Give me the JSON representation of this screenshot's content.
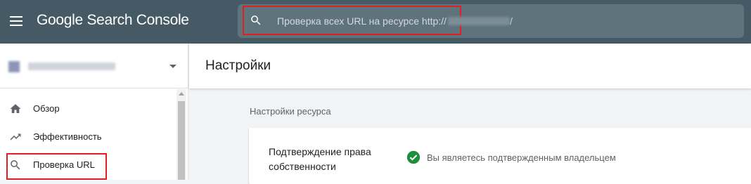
{
  "app": {
    "logo_google": "Google",
    "logo_product": "Search Console"
  },
  "search": {
    "placeholder": "Проверка всех URL на ресурсе http://",
    "suffix": "/"
  },
  "sidebar": {
    "items": [
      {
        "label": "Обзор",
        "icon": "home-icon"
      },
      {
        "label": "Эффективность",
        "icon": "trending-up-icon"
      },
      {
        "label": "Проверка URL",
        "icon": "search-icon"
      }
    ]
  },
  "main": {
    "title": "Настройки",
    "section_title": "Настройки ресурса",
    "ownership": {
      "label": "Подтверждение права собственности",
      "status": "Вы являетесь подтвержденным владельцем",
      "status_color": "#1e8e3e"
    }
  },
  "colors": {
    "topbar": "#455a64",
    "highlight": "#e02020"
  }
}
